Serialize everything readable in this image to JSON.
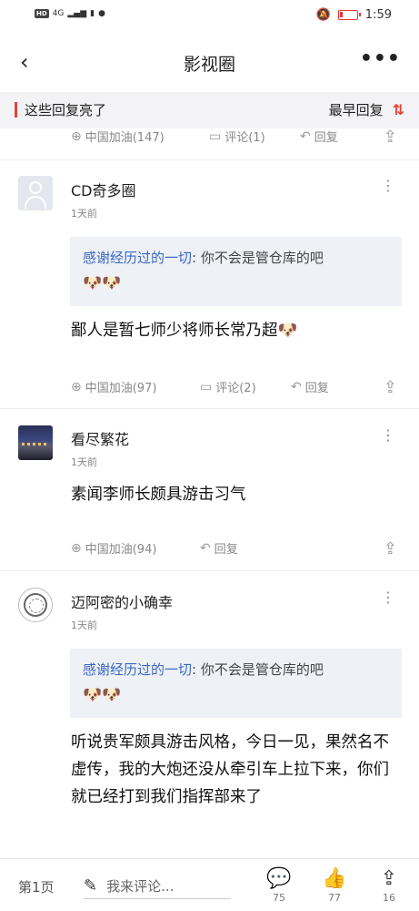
{
  "status_bar": {
    "hd": "HD",
    "net": "4G",
    "time": "1:59"
  },
  "header": {
    "back_icon": "chevron-left-icon",
    "title": "影视圈",
    "more_icon": "more-horizontal-icon"
  },
  "filter": {
    "left_label": "这些回复亮了",
    "right_label": "最早回复",
    "sort_icon": "sort-arrows-icon"
  },
  "top_actions": {
    "cheer": "中国加油(147)",
    "comment": "评论(1)",
    "reply": "回复"
  },
  "comments": [
    {
      "username": "CD奇多圈",
      "time": "1天前",
      "quote_name": "感谢经历过的一切",
      "quote_text": ": 你不会是管仓库的吧",
      "quote_emojis": "🐶🐶",
      "content": "鄙人是暂七师少将师长常乃超🐶",
      "cheer": "中国加油(97)",
      "comment": "评论(2)",
      "reply": "回复"
    },
    {
      "username": "看尽繁花",
      "time": "1天前",
      "content": "素闻李师长颇具游击习气",
      "cheer": "中国加油(94)",
      "reply": "回复"
    },
    {
      "username": "迈阿密的小确幸",
      "time": "1天前",
      "quote_name": "感谢经历过的一切",
      "quote_text": ": 你不会是管仓库的吧",
      "quote_emojis": "🐶🐶",
      "content": "听说贵军颇具游击风格，今日一见，果然名不虚传，我的大炮还没从牵引车上拉下来，你们就已经打到我们指挥部来了"
    }
  ],
  "bottom": {
    "page": "第1页",
    "input_placeholder": "我来评论...",
    "comments_count": "75",
    "likes_count": "77",
    "shares_count": "16"
  },
  "colors": {
    "accent_red": "#e0453c",
    "link_blue": "#3a68c4",
    "quote_bg": "#eef1f6"
  }
}
